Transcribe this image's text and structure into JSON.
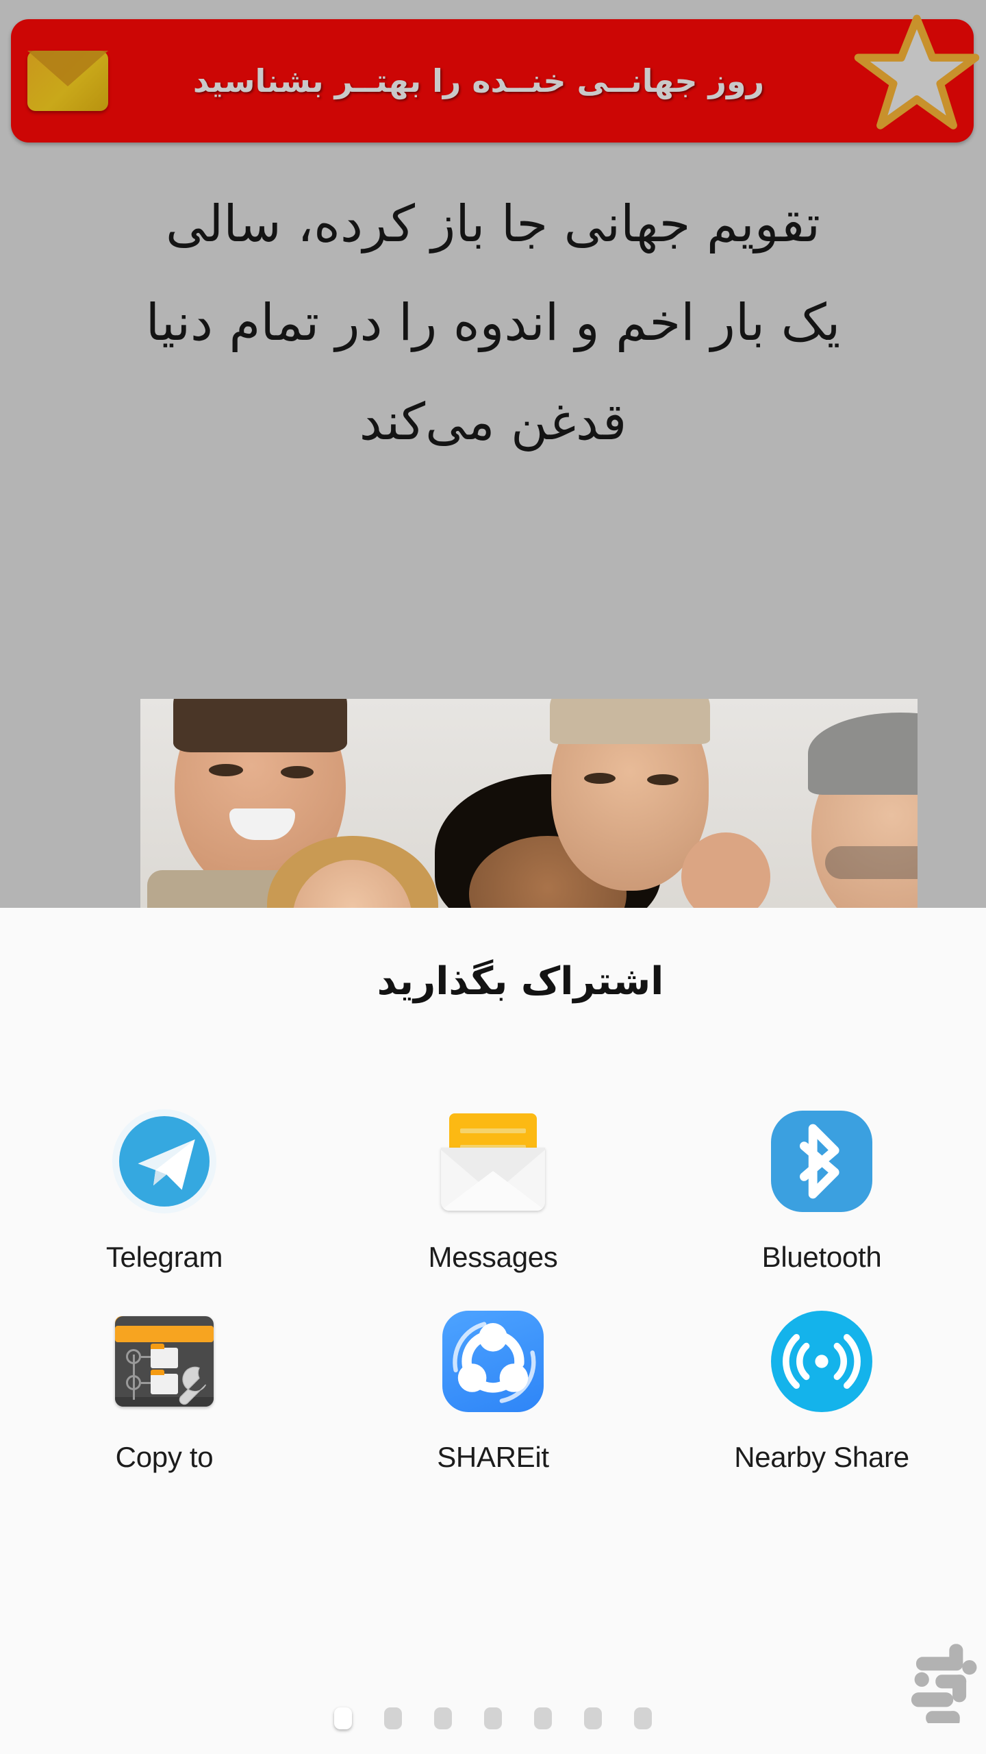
{
  "header": {
    "title": "روز جهانــی خنــده را بهتــر بشناسید",
    "mail_icon": "envelope-icon",
    "star_icon": "star-icon",
    "bg_color": "#cc0605",
    "text_color": "#c9c9c9",
    "accent_gold": "#c9a81a"
  },
  "content": {
    "quote_lines": [
      "تقویم جهانی جا باز کرده، سالی",
      "یک بار اخم و اندوه را در تمام دنیا",
      "قدغن می‌کند"
    ],
    "photo_alt": "گروهی از افراد خندان",
    "background_color": "#b4b4b4"
  },
  "share_sheet": {
    "title": "اشتراک بگذارید",
    "background_color": "#fafafa",
    "apps": [
      {
        "label": "Telegram",
        "icon": "telegram-icon",
        "color": "#35a8e0"
      },
      {
        "label": "Messages",
        "icon": "messages-icon",
        "color": "#fcb913"
      },
      {
        "label": "Bluetooth",
        "icon": "bluetooth-icon",
        "color": "#3ba0e0"
      },
      {
        "label": "Copy to",
        "icon": "copy-to-icon",
        "color": "#4a4a4a"
      },
      {
        "label": "SHAREit",
        "icon": "shareit-icon",
        "color": "#2e85f7"
      },
      {
        "label": "Nearby Share",
        "icon": "nearby-share-icon",
        "color": "#14b3eb"
      }
    ],
    "page_dots": {
      "count": 7,
      "active_index": 0
    }
  },
  "watermark": {
    "name": "app-watermark-logo",
    "color": "#a6a6a6"
  }
}
